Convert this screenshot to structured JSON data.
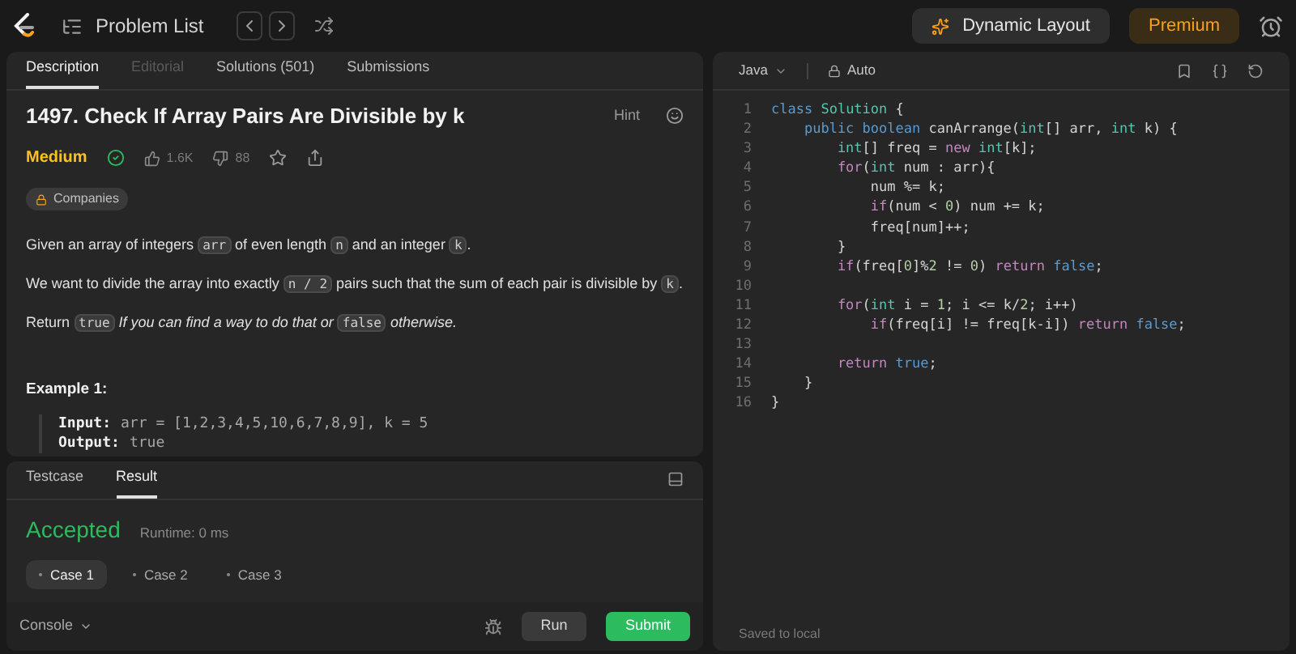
{
  "top_bar": {
    "problem_list": "Problem List",
    "dynamic_layout": "Dynamic Layout",
    "premium": "Premium"
  },
  "description_panel": {
    "tabs": [
      {
        "label": "Description",
        "selected": true,
        "disabled": false
      },
      {
        "label": "Editorial",
        "selected": false,
        "disabled": true
      },
      {
        "label": "Solutions (501)",
        "selected": false,
        "disabled": false
      },
      {
        "label": "Submissions",
        "selected": false,
        "disabled": false
      }
    ],
    "title": "1497. Check If Array Pairs Are Divisible by k",
    "hint": "Hint",
    "difficulty": "Medium",
    "solved": true,
    "likes": "1.6K",
    "dislikes": "88",
    "companies": "Companies",
    "paragraphs": [
      [
        {
          "kind": "text",
          "text": "Given an array of integers "
        },
        {
          "kind": "code",
          "text": "arr"
        },
        {
          "kind": "text",
          "text": " of even length "
        },
        {
          "kind": "code",
          "text": "n"
        },
        {
          "kind": "text",
          "text": " and an integer "
        },
        {
          "kind": "code",
          "text": "k"
        },
        {
          "kind": "text",
          "text": "."
        }
      ],
      [
        {
          "kind": "text",
          "text": "We want to divide the array into exactly "
        },
        {
          "kind": "code",
          "text": "n / 2"
        },
        {
          "kind": "text",
          "text": " pairs such that the sum of each pair is divisible by "
        },
        {
          "kind": "code",
          "text": "k"
        },
        {
          "kind": "text",
          "text": "."
        }
      ],
      [
        {
          "kind": "text",
          "text": "Return "
        },
        {
          "kind": "code",
          "text": "true"
        },
        {
          "kind": "italic",
          "text": " If you can find a way to do that or "
        },
        {
          "kind": "code",
          "text": "false"
        },
        {
          "kind": "italic",
          "text": " otherwise."
        }
      ]
    ],
    "example": {
      "heading": "Example 1:",
      "lines": [
        {
          "label": "Input:",
          "value": "arr = [1,2,3,4,5,10,6,7,8,9], k = 5"
        },
        {
          "label": "Output:",
          "value": "true"
        }
      ]
    }
  },
  "result_panel": {
    "tabs": [
      {
        "label": "Testcase",
        "selected": false
      },
      {
        "label": "Result",
        "selected": true
      }
    ],
    "status": "Accepted",
    "runtime": "Runtime: 0 ms",
    "cases": [
      {
        "label": "Case 1",
        "selected": true
      },
      {
        "label": "Case 2",
        "selected": false
      },
      {
        "label": "Case 3",
        "selected": false
      }
    ],
    "console": "Console",
    "run": "Run",
    "submit": "Submit"
  },
  "editor": {
    "language": "Java",
    "mode": "Auto",
    "status": "Saved to local",
    "lines": [
      {
        "number": "1",
        "tokens": [
          {
            "kind": "decl",
            "text": "class"
          },
          {
            "kind": "type",
            "text": " Solution"
          },
          {
            "kind": "plain",
            "text": " {"
          }
        ]
      },
      {
        "number": "2",
        "tokens": [
          {
            "kind": "decl",
            "text": "    public boolean"
          },
          {
            "kind": "plain",
            "text": " canArrange("
          },
          {
            "kind": "type",
            "text": "int"
          },
          {
            "kind": "plain",
            "text": "[] arr, "
          },
          {
            "kind": "type",
            "text": "int"
          },
          {
            "kind": "plain",
            "text": " k) {"
          }
        ]
      },
      {
        "number": "3",
        "tokens": [
          {
            "kind": "type",
            "text": "        int"
          },
          {
            "kind": "plain",
            "text": "[] freq = "
          },
          {
            "kind": "keyword",
            "text": "new"
          },
          {
            "kind": "type",
            "text": " int"
          },
          {
            "kind": "plain",
            "text": "[k];"
          }
        ]
      },
      {
        "number": "4",
        "tokens": [
          {
            "kind": "keyword",
            "text": "        for"
          },
          {
            "kind": "plain",
            "text": "("
          },
          {
            "kind": "type",
            "text": "int"
          },
          {
            "kind": "plain",
            "text": " num : arr){"
          }
        ]
      },
      {
        "number": "5",
        "tokens": [
          {
            "kind": "plain",
            "text": "            num %= k;"
          }
        ]
      },
      {
        "number": "6",
        "tokens": [
          {
            "kind": "keyword",
            "text": "            if"
          },
          {
            "kind": "plain",
            "text": "(num < "
          },
          {
            "kind": "number",
            "text": "0"
          },
          {
            "kind": "plain",
            "text": ") num += k;"
          }
        ]
      },
      {
        "number": "7",
        "tokens": [
          {
            "kind": "plain",
            "text": "            freq[num]++;"
          }
        ]
      },
      {
        "number": "8",
        "tokens": [
          {
            "kind": "plain",
            "text": "        }"
          }
        ]
      },
      {
        "number": "9",
        "tokens": [
          {
            "kind": "keyword",
            "text": "        if"
          },
          {
            "kind": "plain",
            "text": "(freq["
          },
          {
            "kind": "number",
            "text": "0"
          },
          {
            "kind": "plain",
            "text": "]%"
          },
          {
            "kind": "number",
            "text": "2"
          },
          {
            "kind": "plain",
            "text": " != "
          },
          {
            "kind": "number",
            "text": "0"
          },
          {
            "kind": "plain",
            "text": ") "
          },
          {
            "kind": "keyword",
            "text": "return"
          },
          {
            "kind": "decl",
            "text": " false"
          },
          {
            "kind": "plain",
            "text": ";"
          }
        ]
      },
      {
        "number": "10"
      },
      {
        "number": "11",
        "tokens": [
          {
            "kind": "keyword",
            "text": "        for"
          },
          {
            "kind": "plain",
            "text": "("
          },
          {
            "kind": "type",
            "text": "int"
          },
          {
            "kind": "plain",
            "text": " i = "
          },
          {
            "kind": "number",
            "text": "1"
          },
          {
            "kind": "plain",
            "text": "; i <= k/"
          },
          {
            "kind": "number",
            "text": "2"
          },
          {
            "kind": "plain",
            "text": "; i++)"
          }
        ]
      },
      {
        "number": "12",
        "tokens": [
          {
            "kind": "keyword",
            "text": "            if"
          },
          {
            "kind": "plain",
            "text": "(freq[i] != freq[k-i]) "
          },
          {
            "kind": "keyword",
            "text": "return"
          },
          {
            "kind": "decl",
            "text": " false"
          },
          {
            "kind": "plain",
            "text": ";"
          }
        ]
      },
      {
        "number": "13"
      },
      {
        "number": "14",
        "tokens": [
          {
            "kind": "keyword",
            "text": "        return"
          },
          {
            "kind": "decl",
            "text": " true"
          },
          {
            "kind": "plain",
            "text": ";"
          }
        ]
      },
      {
        "number": "15",
        "tokens": [
          {
            "kind": "plain",
            "text": "    }"
          }
        ]
      },
      {
        "number": "16",
        "tokens": [
          {
            "kind": "plain",
            "text": "}"
          }
        ]
      }
    ]
  }
}
